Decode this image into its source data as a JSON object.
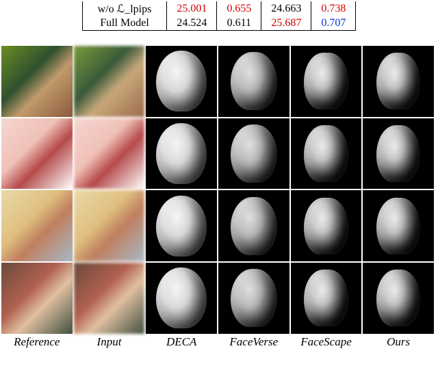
{
  "table": {
    "rows": [
      {
        "label": "w/o ℒ_lpips",
        "c1": {
          "val": "25.001",
          "cls": "red"
        },
        "c2": {
          "val": "0.655",
          "cls": "red"
        },
        "c3": {
          "val": "24.663",
          "cls": ""
        },
        "c4": {
          "val": "0.738",
          "cls": "red"
        }
      },
      {
        "label": "Full Model",
        "c1": {
          "val": "24.524",
          "cls": ""
        },
        "c2": {
          "val": "0.611",
          "cls": ""
        },
        "c3": {
          "val": "25.687",
          "cls": "red"
        },
        "c4": {
          "val": "0.707",
          "cls": "blue"
        }
      }
    ]
  },
  "columns": [
    "Reference",
    "Input",
    "DECA",
    "FaceVerse",
    "FaceScape",
    "Ours"
  ]
}
